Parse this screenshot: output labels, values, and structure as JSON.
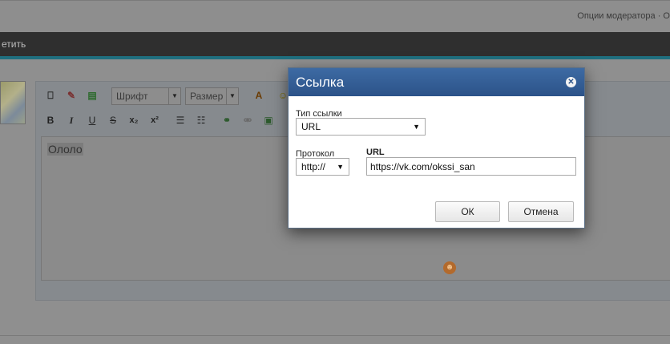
{
  "page": {
    "moderator_options": "Опции модератора · О",
    "nav_text": "етить",
    "editor": {
      "font_label": "Шрифт",
      "size_label": "Размер",
      "content_text": "Ололо",
      "toolbar_icons_row1": [
        "source-icon",
        "eraser-icon",
        "template-icon",
        "text-color-icon",
        "smiley-icon"
      ],
      "toolbar_icons_row2": [
        "bold-icon",
        "italic-icon",
        "underline-icon",
        "strike-icon",
        "subscript-icon",
        "superscript-icon",
        "numbered-list-icon",
        "bulleted-list-icon",
        "link-icon",
        "unlink-icon",
        "image-icon"
      ]
    }
  },
  "dialog": {
    "title": "Ссылка",
    "link_type_label": "Тип ссылки",
    "link_type_value": "URL",
    "protocol_label": "Протокол",
    "protocol_value": "http://",
    "url_label": "URL",
    "url_value": "https://vk.com/okssi_san",
    "ok_label": "ОК",
    "cancel_label": "Отмена"
  }
}
